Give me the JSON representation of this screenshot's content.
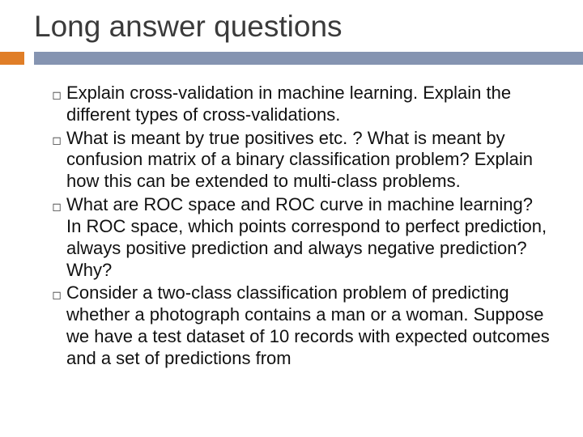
{
  "title": "Long answer questions",
  "bullet_glyph": "◻",
  "items": [
    "Explain cross-validation in machine learning. Explain the different types of cross-validations.",
    "What is meant by true positives etc. ? What is meant by confusion matrix of a binary classification problem? Explain how this can be extended to multi-class problems.",
    "What are ROC space and ROC curve in machine learning? In ROC space, which points correspond to perfect prediction, always positive prediction and always negative prediction? Why?",
    "Consider a two-class classification problem of predicting whether a photograph contains a man or a woman. Suppose we have a test dataset of 10 records with expected outcomes and a set of predictions from"
  ]
}
